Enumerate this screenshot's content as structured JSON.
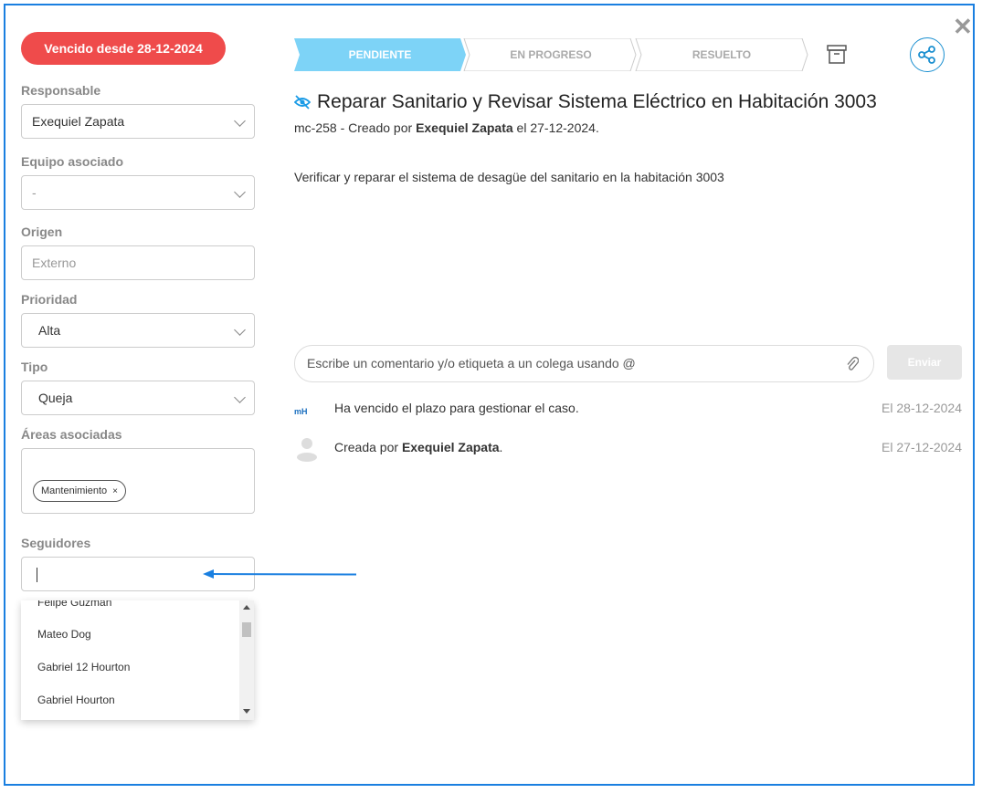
{
  "overdue_badge": "Vencido desde 28-12-2024",
  "fields": {
    "responsable": {
      "label": "Responsable",
      "value": "Exequiel Zapata"
    },
    "equipo": {
      "label": "Equipo asociado",
      "value": "-"
    },
    "origen": {
      "label": "Origen",
      "value": "Externo"
    },
    "prioridad": {
      "label": "Prioridad",
      "value": "Alta"
    },
    "tipo": {
      "label": "Tipo",
      "value": "Queja"
    },
    "areas": {
      "label": "Áreas asociadas",
      "chips": [
        "Mantenimiento"
      ],
      "chip_remove": "×"
    },
    "seguidores": {
      "label": "Seguidores",
      "options": [
        "Felipe Guzmán",
        "Mateo Dog",
        "Gabriel 12 Hourton",
        "Gabriel Hourton"
      ]
    }
  },
  "steps": [
    "PENDIENTE",
    "EN PROGRESO",
    "RESUELTO"
  ],
  "active_step": "PENDIENTE",
  "colors": {
    "accent": "#1a7fe0",
    "active_step": "#7dd3f7",
    "overdue": "#ef4b4b"
  },
  "ticket": {
    "title": "Reparar Sanitario y Revisar Sistema Eléctrico en Habitación 3003",
    "code_prefix": "mc-258 - Creado por",
    "creator": "Exequiel Zapata",
    "date_suffix": "el 27-12-2024.",
    "description": "Verificar y reparar el sistema de desagüe del sanitario en la habitación 3003"
  },
  "comment": {
    "placeholder": "Escribe un comentario y/o etiqueta a un colega usando @",
    "send_label": "Enviar"
  },
  "activity": [
    {
      "icon": "mH",
      "text": "Ha vencido el plazo para gestionar el caso.",
      "date": "El 28-12-2024"
    },
    {
      "icon": "user-icon",
      "text_prefix": "Creada por",
      "user": "Exequiel Zapata",
      "text_suffix": ".",
      "date": "El 27-12-2024"
    }
  ],
  "close_label": "✕"
}
